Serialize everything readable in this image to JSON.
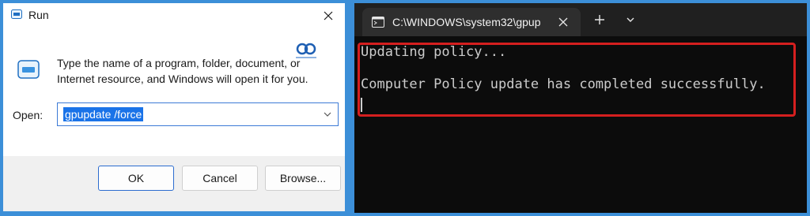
{
  "run_dialog": {
    "title": "Run",
    "description": "Type the name of a program, folder, document, or Internet resource, and Windows will open it for you.",
    "open_label": "Open:",
    "open_value": "gpupdate /force",
    "buttons": {
      "ok": "OK",
      "cancel": "Cancel",
      "browse": "Browse..."
    }
  },
  "terminal": {
    "tab_title": "C:\\WINDOWS\\system32\\gpup",
    "lines": [
      "Updating policy...",
      "Computer Policy update has completed successfully."
    ],
    "highlight_color": "#d51f1f",
    "background_color": "#0c0c0c"
  },
  "icons": {
    "run_app": "run-app-icon",
    "close": "close-icon",
    "watermark": "logo-watermark-icon",
    "chevron": "chevron-down-icon",
    "terminal_tab": "command-prompt-icon",
    "new_tab": "plus-icon"
  }
}
